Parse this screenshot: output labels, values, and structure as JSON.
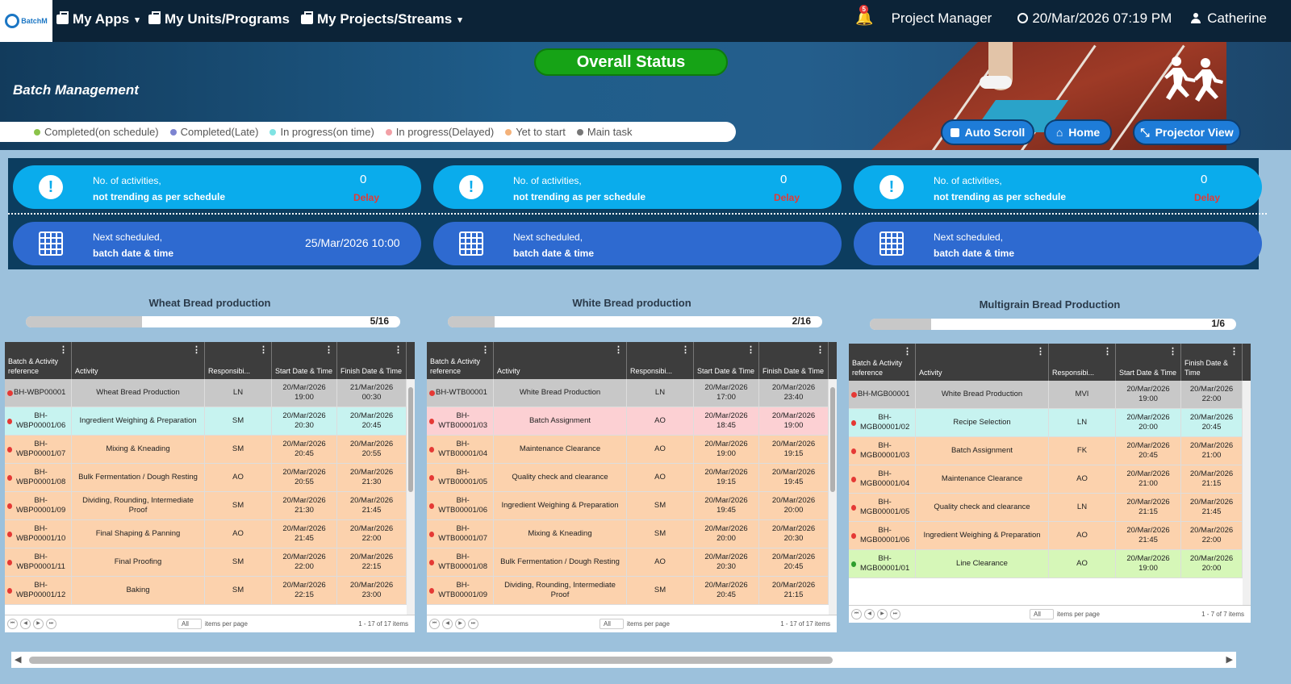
{
  "topbar": {
    "logo_text": "BatchM",
    "menus": [
      {
        "label": "My Apps",
        "caret": true
      },
      {
        "label": "My Units/Programs",
        "caret": false
      },
      {
        "label": "My Projects/Streams",
        "caret": true
      }
    ],
    "notifications": "5",
    "role": "Project Manager",
    "datetime": "20/Mar/2026 07:19 PM",
    "user": "Catherine"
  },
  "banner": {
    "overall_status": "Overall Status",
    "title": "Batch Management",
    "legend": [
      {
        "label": "Completed(on schedule)",
        "color": "#8bc34a"
      },
      {
        "label": "Completed(Late)",
        "color": "#7c84d1"
      },
      {
        "label": "In progress(on time)",
        "color": "#7fe3e3"
      },
      {
        "label": "In progress(Delayed)",
        "color": "#f2a0a6"
      },
      {
        "label": "Yet to start",
        "color": "#f4b27a"
      },
      {
        "label": "Main task",
        "color": "#777777"
      }
    ],
    "auto_scroll": "Auto Scroll",
    "home": "Home",
    "projector_view": "Projector View"
  },
  "stats": [
    {
      "line1": "No. of activities,",
      "line2": "not trending as per schedule",
      "count": "0",
      "delay": "Delay",
      "next1": "Next scheduled,",
      "next2": "batch date & time",
      "next_date": "25/Mar/2026 10:00"
    },
    {
      "line1": "No. of activities,",
      "line2": "not trending as per schedule",
      "count": "0",
      "delay": "Delay",
      "next1": "Next scheduled,",
      "next2": "batch date & time",
      "next_date": ""
    },
    {
      "line1": "No. of activities,",
      "line2": "not trending as per schedule",
      "count": "0",
      "delay": "Delay",
      "next1": "Next scheduled,",
      "next2": "batch date & time",
      "next_date": ""
    }
  ],
  "columns": [
    "Batch & Activity reference",
    "Activity",
    "Responsibi...",
    "Start Date & Time",
    "Finish Date & Time"
  ],
  "colors": {
    "main": "#c8c8c8",
    "delayed": "#fcd0d3",
    "ontime": "#c7f3f0",
    "yet": "#fcd2ad",
    "completed": "#d6f7b8"
  },
  "panels": [
    {
      "title": "Wheat Bread production",
      "progress_label": "5/16",
      "progress": 0.31,
      "footer_all": "All",
      "footer_ipp": "items per page",
      "footer_count": "1 - 17 of 17 items",
      "rows": [
        {
          "ref": "BH-WBP00001",
          "activity": "Wheat Bread Production",
          "resp": "LN",
          "start": "20/Mar/2026 19:00",
          "finish": "21/Mar/2026 00:30",
          "status": "main",
          "dot": "#e53935"
        },
        {
          "ref": "BH-WBP00001/06",
          "activity": "Ingredient Weighing & Preparation",
          "resp": "SM",
          "start": "20/Mar/2026 20:30",
          "finish": "20/Mar/2026 20:45",
          "status": "ontime",
          "dot": "#e53935"
        },
        {
          "ref": "BH-WBP00001/07",
          "activity": "Mixing & Kneading",
          "resp": "SM",
          "start": "20/Mar/2026 20:45",
          "finish": "20/Mar/2026 20:55",
          "status": "yet",
          "dot": "#e53935"
        },
        {
          "ref": "BH-WBP00001/08",
          "activity": "Bulk Fermentation / Dough Resting",
          "resp": "AO",
          "start": "20/Mar/2026 20:55",
          "finish": "20/Mar/2026 21:30",
          "status": "yet",
          "dot": "#e53935"
        },
        {
          "ref": "BH-WBP00001/09",
          "activity": "Dividing, Rounding, Intermediate Proof",
          "resp": "SM",
          "start": "20/Mar/2026 21:30",
          "finish": "20/Mar/2026 21:45",
          "status": "yet",
          "dot": "#e53935"
        },
        {
          "ref": "BH-WBP00001/10",
          "activity": "Final Shaping & Panning",
          "resp": "AO",
          "start": "20/Mar/2026 21:45",
          "finish": "20/Mar/2026 22:00",
          "status": "yet",
          "dot": "#e53935"
        },
        {
          "ref": "BH-WBP00001/11",
          "activity": "Final Proofing",
          "resp": "SM",
          "start": "20/Mar/2026 22:00",
          "finish": "20/Mar/2026 22:15",
          "status": "yet",
          "dot": "#e53935"
        },
        {
          "ref": "BH-WBP00001/12",
          "activity": "Baking",
          "resp": "SM",
          "start": "20/Mar/2026 22:15",
          "finish": "20/Mar/2026 23:00",
          "status": "yet",
          "dot": "#e53935"
        }
      ]
    },
    {
      "title": "White Bread production",
      "progress_label": "2/16",
      "progress": 0.125,
      "footer_all": "All",
      "footer_ipp": "items per page",
      "footer_count": "1 - 17 of 17 items",
      "rows": [
        {
          "ref": "BH-WTB00001",
          "activity": "White Bread Production",
          "resp": "LN",
          "start": "20/Mar/2026 17:00",
          "finish": "20/Mar/2026 23:40",
          "status": "main",
          "dot": "#e53935"
        },
        {
          "ref": "BH-WTB00001/03",
          "activity": "Batch Assignment",
          "resp": "AO",
          "start": "20/Mar/2026 18:45",
          "finish": "20/Mar/2026 19:00",
          "status": "delayed",
          "dot": "#e53935"
        },
        {
          "ref": "BH-WTB00001/04",
          "activity": "Maintenance Clearance",
          "resp": "AO",
          "start": "20/Mar/2026 19:00",
          "finish": "20/Mar/2026 19:15",
          "status": "yet",
          "dot": "#e53935"
        },
        {
          "ref": "BH-WTB00001/05",
          "activity": "Quality check and clearance",
          "resp": "AO",
          "start": "20/Mar/2026 19:15",
          "finish": "20/Mar/2026 19:45",
          "status": "yet",
          "dot": "#e53935"
        },
        {
          "ref": "BH-WTB00001/06",
          "activity": "Ingredient Weighing & Preparation",
          "resp": "SM",
          "start": "20/Mar/2026 19:45",
          "finish": "20/Mar/2026 20:00",
          "status": "yet",
          "dot": "#e53935"
        },
        {
          "ref": "BH-WTB00001/07",
          "activity": "Mixing & Kneading",
          "resp": "SM",
          "start": "20/Mar/2026 20:00",
          "finish": "20/Mar/2026 20:30",
          "status": "yet",
          "dot": "#e53935"
        },
        {
          "ref": "BH-WTB00001/08",
          "activity": "Bulk Fermentation / Dough Resting",
          "resp": "AO",
          "start": "20/Mar/2026 20:30",
          "finish": "20/Mar/2026 20:45",
          "status": "yet",
          "dot": "#e53935"
        },
        {
          "ref": "BH-WTB00001/09",
          "activity": "Dividing, Rounding, Intermediate Proof",
          "resp": "SM",
          "start": "20/Mar/2026 20:45",
          "finish": "20/Mar/2026 21:15",
          "status": "yet",
          "dot": "#e53935"
        }
      ]
    },
    {
      "title": "Multigrain Bread Production",
      "progress_label": "1/6",
      "progress": 0.167,
      "footer_all": "All",
      "footer_ipp": "items per page",
      "footer_count": "1 - 7 of 7 items",
      "rows": [
        {
          "ref": "BH-MGB00001",
          "activity": "White Bread Production",
          "resp": "MVI",
          "start": "20/Mar/2026 19:00",
          "finish": "20/Mar/2026 22:00",
          "status": "main",
          "dot": "#e53935"
        },
        {
          "ref": "BH-MGB00001/02",
          "activity": "Recipe Selection",
          "resp": "LN",
          "start": "20/Mar/2026 20:00",
          "finish": "20/Mar/2026 20:45",
          "status": "ontime",
          "dot": "#e53935"
        },
        {
          "ref": "BH-MGB00001/03",
          "activity": "Batch Assignment",
          "resp": "FK",
          "start": "20/Mar/2026 20:45",
          "finish": "20/Mar/2026 21:00",
          "status": "yet",
          "dot": "#e53935"
        },
        {
          "ref": "BH-MGB00001/04",
          "activity": "Maintenance Clearance",
          "resp": "AO",
          "start": "20/Mar/2026 21:00",
          "finish": "20/Mar/2026 21:15",
          "status": "yet",
          "dot": "#e53935"
        },
        {
          "ref": "BH-MGB00001/05",
          "activity": "Quality check and clearance",
          "resp": "LN",
          "start": "20/Mar/2026 21:15",
          "finish": "20/Mar/2026 21:45",
          "status": "yet",
          "dot": "#e53935"
        },
        {
          "ref": "BH-MGB00001/06",
          "activity": "Ingredient Weighing & Preparation",
          "resp": "AO",
          "start": "20/Mar/2026 21:45",
          "finish": "20/Mar/2026 22:00",
          "status": "yet",
          "dot": "#e53935"
        },
        {
          "ref": "BH-MGB00001/01",
          "activity": "Line Clearance",
          "resp": "AO",
          "start": "20/Mar/2026 19:00",
          "finish": "20/Mar/2026 20:00",
          "status": "completed",
          "dot": "#2e9e2e"
        }
      ]
    }
  ]
}
